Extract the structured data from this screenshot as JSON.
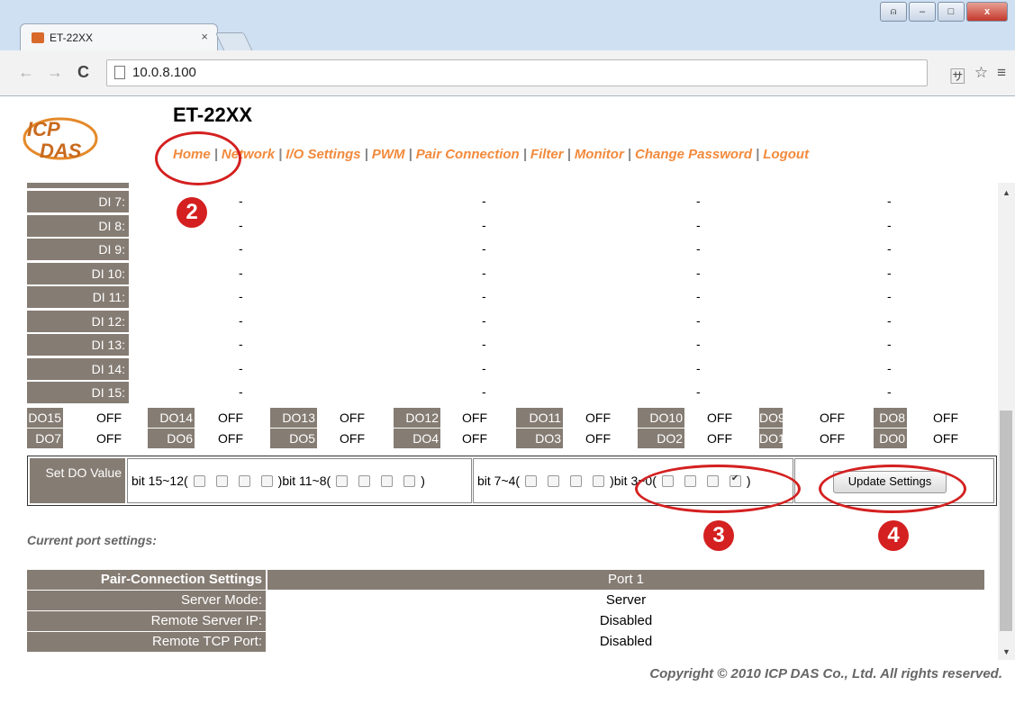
{
  "browser": {
    "tab_title": "ET-22XX",
    "tab_close": "×",
    "url": "10.0.8.100",
    "nav_back": "←",
    "nav_forward": "→",
    "nav_reload": "C",
    "translate": "🈂",
    "star": "☆",
    "menu": "≡",
    "win_min": "–",
    "win_max": "□",
    "win_close": "x",
    "win_user": "⍝"
  },
  "header": {
    "logo_text": "ICP DAS",
    "title": "ET-22XX",
    "nav": [
      "Home",
      "Network",
      "I/O Settings",
      "PWM",
      "Pair Connection",
      "Filter",
      "Monitor",
      "Change Password",
      "Logout"
    ],
    "sep": "|"
  },
  "di_rows": [
    {
      "label": "DI 7:",
      "values": [
        "-",
        "-",
        "-",
        "-"
      ]
    },
    {
      "label": "DI 8:",
      "values": [
        "-",
        "-",
        "-",
        "-"
      ]
    },
    {
      "label": "DI 9:",
      "values": [
        "-",
        "-",
        "-",
        "-"
      ]
    },
    {
      "label": "DI 10:",
      "values": [
        "-",
        "-",
        "-",
        "-"
      ]
    },
    {
      "label": "DI 11:",
      "values": [
        "-",
        "-",
        "-",
        "-"
      ]
    },
    {
      "label": "DI 12:",
      "values": [
        "-",
        "-",
        "-",
        "-"
      ]
    },
    {
      "label": "DI 13:",
      "values": [
        "-",
        "-",
        "-",
        "-"
      ]
    },
    {
      "label": "DI 14:",
      "values": [
        "-",
        "-",
        "-",
        "-"
      ]
    },
    {
      "label": "DI 15:",
      "values": [
        "-",
        "-",
        "-",
        "-"
      ]
    }
  ],
  "do_rows": [
    [
      {
        "label": "DO15",
        "value": "OFF"
      },
      {
        "label": "DO14",
        "value": "OFF"
      },
      {
        "label": "DO13",
        "value": "OFF"
      },
      {
        "label": "DO12",
        "value": "OFF"
      },
      {
        "label": "DO11",
        "value": "OFF"
      },
      {
        "label": "DO10",
        "value": "OFF"
      },
      {
        "label": "DO9",
        "value": "OFF"
      },
      {
        "label": "DO8",
        "value": "OFF"
      }
    ],
    [
      {
        "label": "DO7",
        "value": "OFF"
      },
      {
        "label": "DO6",
        "value": "OFF"
      },
      {
        "label": "DO5",
        "value": "OFF"
      },
      {
        "label": "DO4",
        "value": "OFF"
      },
      {
        "label": "DO3",
        "value": "OFF"
      },
      {
        "label": "DO2",
        "value": "OFF"
      },
      {
        "label": "DO1",
        "value": "OFF"
      },
      {
        "label": "DO0",
        "value": "OFF"
      }
    ]
  ],
  "set_do": {
    "label": "Set DO Value",
    "groups": [
      {
        "prefix": "bit 15~12(",
        "checked": [
          false,
          false,
          false,
          false
        ],
        "suffix": ")"
      },
      {
        "prefix": "bit 11~8(",
        "checked": [
          false,
          false,
          false,
          false
        ],
        "suffix": ")"
      },
      {
        "prefix": "bit 7~4(",
        "checked": [
          false,
          false,
          false,
          false
        ],
        "suffix": ")"
      },
      {
        "prefix": "bit 3~0(",
        "checked": [
          false,
          false,
          false,
          true
        ],
        "suffix": ")"
      }
    ],
    "update_button": "Update Settings"
  },
  "current_port_settings": "Current port settings:",
  "pair_connection": {
    "header_label": "Pair-Connection Settings",
    "header_value": "Port 1",
    "rows": [
      {
        "label": "Server Mode:",
        "value": "Server"
      },
      {
        "label": "Remote Server IP:",
        "value": "Disabled"
      },
      {
        "label": "Remote TCP Port:",
        "value": "Disabled"
      }
    ]
  },
  "copyright": "Copyright © 2010 ICP DAS Co., Ltd. All rights reserved.",
  "annotations": [
    "2",
    "3",
    "4"
  ]
}
